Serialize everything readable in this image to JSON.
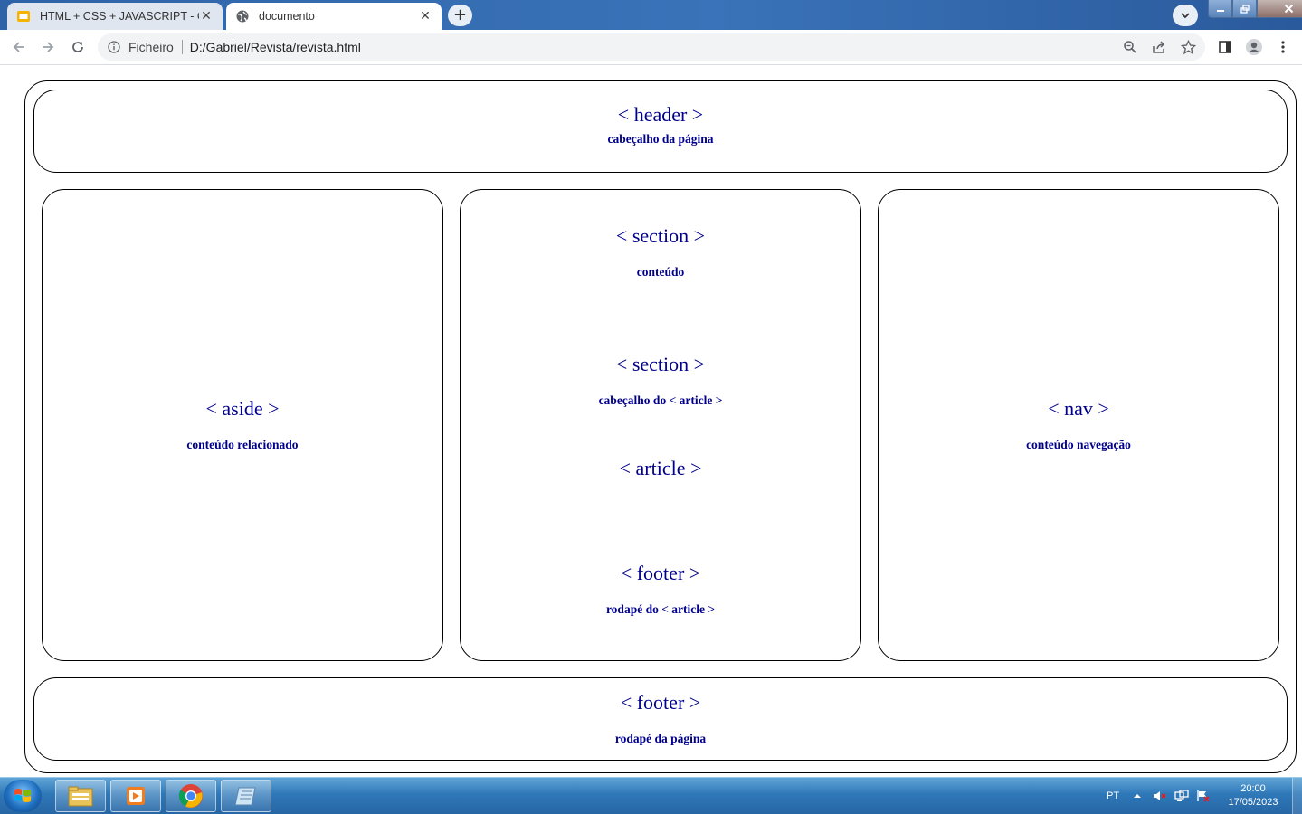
{
  "browser": {
    "tabs": [
      {
        "title": "HTML + CSS + JAVASCRIPT - Goo",
        "icon": "slides-icon",
        "active": false
      },
      {
        "title": "documento",
        "icon": "globe-icon",
        "active": true
      }
    ],
    "new_tab_label": "+",
    "omnibox": {
      "site_label": "Ficheiro",
      "url": "D:/Gabriel/Revista/revista.html"
    }
  },
  "page": {
    "header": {
      "tag": "< header >",
      "desc": "cabeçalho da página"
    },
    "aside": {
      "tag": "< aside >",
      "desc": "conteúdo relacionado"
    },
    "main": {
      "section1": {
        "tag": "< section >",
        "desc": "conteúdo"
      },
      "section2": {
        "tag": "< section >",
        "desc": "cabeçalho do < article >"
      },
      "article": {
        "tag": "< article >"
      },
      "footer": {
        "tag": "< footer >",
        "desc": "rodapé do < article >"
      }
    },
    "nav": {
      "tag": "< nav >",
      "desc": "conteúdo navegação"
    },
    "footer": {
      "tag": "< footer >",
      "desc": "rodapé da página"
    }
  },
  "taskbar": {
    "language": "PT",
    "time": "20:00",
    "date": "17/05/2023"
  },
  "colors": {
    "text_accent": "#00008b",
    "border": "#000000",
    "taskbar": "#2f78b8"
  }
}
